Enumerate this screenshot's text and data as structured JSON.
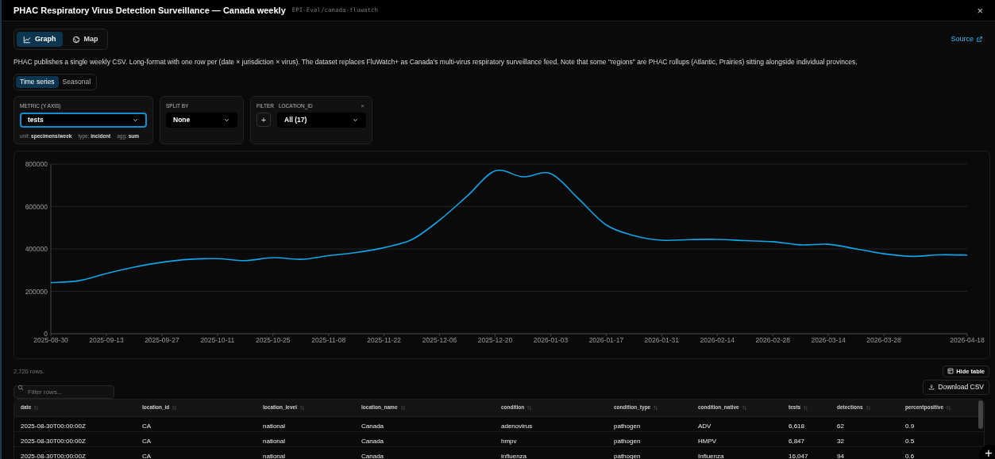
{
  "window": {
    "title": "PHAC Respiratory Virus Detection Surveillance — Canada weekly",
    "subtitle": "EPI-Eval/canada-fluwatch",
    "close": "×"
  },
  "view_tabs": [
    {
      "label": "Graph",
      "kind": "chart",
      "selected": true
    },
    {
      "label": "Map",
      "kind": "globe",
      "selected": false
    }
  ],
  "source_link": "Source",
  "description": "PHAC publishes a single weekly CSV. Long-format with one row per (date × jurisdiction × virus). The dataset replaces FluWatch+ as Canada's multi-virus respiratory surveillance feed. Note that some \"regions\" are PHAC rollups (Atlantic, Prairies) sitting alongside individual provinces.",
  "mode_tabs": [
    {
      "label": "Time series",
      "selected": true
    },
    {
      "label": "Seasonal",
      "selected": false
    }
  ],
  "controls": {
    "metric": {
      "label": "METRIC (Y AXIS)",
      "value": "tests",
      "focused": true,
      "meta": [
        {
          "key": "unit:",
          "value": "specimens/week"
        },
        {
          "key": "type:",
          "value": "incident"
        },
        {
          "key": "agg:",
          "value": "sum"
        }
      ]
    },
    "split": {
      "label": "SPLIT BY",
      "value": "None"
    },
    "filter": {
      "label": "FILTER",
      "field": "LOCATION_ID",
      "value": "All (17)",
      "add": "+",
      "remove": "×"
    }
  },
  "chart_data": {
    "type": "line",
    "x": [
      "2025-08-30",
      "2025-09-06",
      "2025-09-13",
      "2025-09-20",
      "2025-09-27",
      "2025-10-04",
      "2025-10-11",
      "2025-10-18",
      "2025-10-25",
      "2025-11-01",
      "2025-11-08",
      "2025-11-15",
      "2025-11-22",
      "2025-11-29",
      "2025-12-06",
      "2025-12-13",
      "2025-12-20",
      "2025-12-27",
      "2026-01-03",
      "2026-01-10",
      "2026-01-17",
      "2026-01-24",
      "2026-01-31",
      "2026-02-07",
      "2026-02-14",
      "2026-02-21",
      "2026-02-28",
      "2026-03-07",
      "2026-03-14",
      "2026-03-21",
      "2026-03-28",
      "2026-04-04",
      "2026-04-11",
      "2026-04-18"
    ],
    "values": [
      241000,
      250000,
      284000,
      314000,
      337000,
      351000,
      354000,
      345000,
      359000,
      351000,
      368000,
      383000,
      406000,
      444000,
      536000,
      650000,
      768000,
      740000,
      755000,
      637000,
      513000,
      463000,
      441000,
      444000,
      445000,
      439000,
      434000,
      419000,
      422000,
      400000,
      377000,
      365000,
      372000,
      371000
    ],
    "grid": true,
    "xlim": [
      "2025-08-30",
      "2026-04-18"
    ],
    "ylim": [
      0,
      800000
    ],
    "yticks": [
      0,
      200000,
      400000,
      600000,
      800000
    ],
    "xticks": [
      "2025-08-30",
      "2025-09-13",
      "2025-09-27",
      "2025-10-11",
      "2025-10-25",
      "2025-11-08",
      "2025-11-22",
      "2025-12-06",
      "2025-12-20",
      "2026-01-03",
      "2026-01-17",
      "2026-01-31",
      "2026-02-14",
      "2026-02-28",
      "2026-03-14",
      "2026-03-28",
      "2026-04-18"
    ]
  },
  "row_count": "2,720 rows.",
  "hide_table": "Hide table",
  "filter_placeholder": "Filter rows...",
  "download": "Download CSV",
  "table": {
    "columns": [
      "date",
      "location_id",
      "location_level",
      "location_name",
      "condition",
      "condition_type",
      "condition_native",
      "tests",
      "detections",
      "percentpositive"
    ],
    "rows": [
      [
        "2025-08-30T00:00:00Z",
        "CA",
        "national",
        "Canada",
        "adenovirus",
        "pathogen",
        "ADV",
        "6,618",
        "62",
        "0.9"
      ],
      [
        "2025-08-30T00:00:00Z",
        "CA",
        "national",
        "Canada",
        "hmpv",
        "pathogen",
        "HMPV",
        "6,847",
        "32",
        "0.5"
      ],
      [
        "2025-08-30T00:00:00Z",
        "CA",
        "national",
        "Canada",
        "influenza",
        "pathogen",
        "Influenza",
        "16,047",
        "94",
        "0.6"
      ]
    ]
  },
  "fab": "+"
}
